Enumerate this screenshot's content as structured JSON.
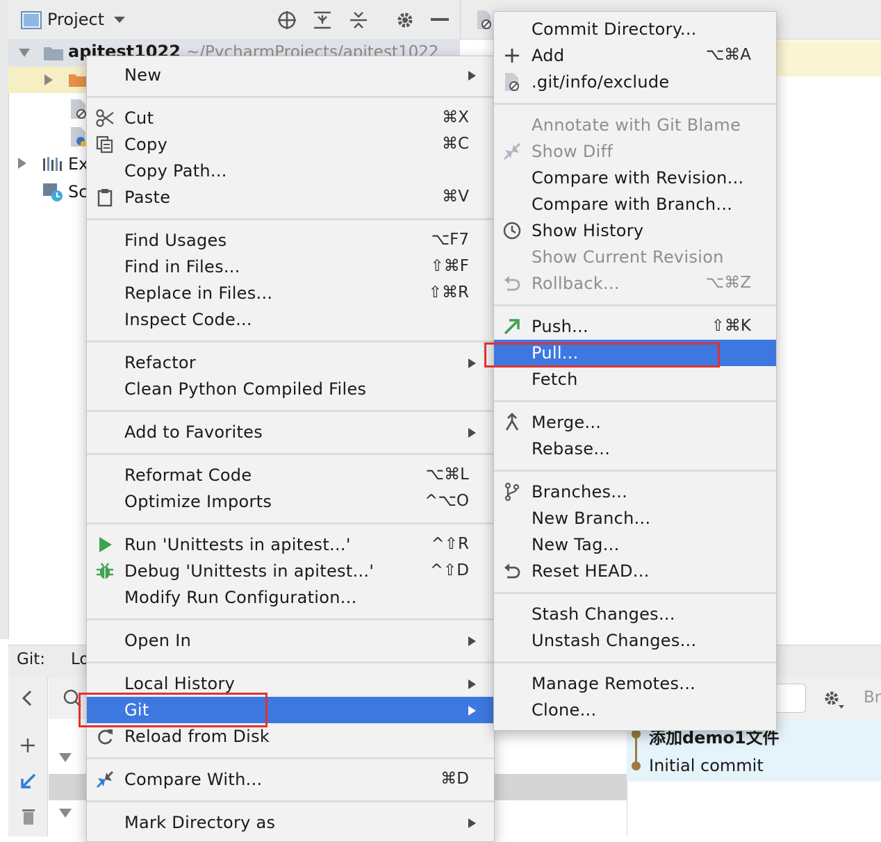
{
  "project_panel": {
    "title": "Project",
    "root_name": "apitest1022",
    "root_path": "~/PycharmProjects/apitest1022",
    "row_ex": "Ex",
    "row_sc": "Sc"
  },
  "git_panel": {
    "label": "Git:",
    "tab_partial": "Lo",
    "right_partial": "Br",
    "log": [
      "添加demo1文件",
      "Initial commit"
    ]
  },
  "context_menu": {
    "items": [
      {
        "label": "New",
        "arrow": true
      },
      {
        "label": "Cut",
        "shortcut": "⌘X",
        "icon": "scissors-icon"
      },
      {
        "label": "Copy",
        "shortcut": "⌘C",
        "icon": "copy-icon"
      },
      {
        "label": "Copy Path..."
      },
      {
        "label": "Paste",
        "shortcut": "⌘V",
        "icon": "clipboard-icon"
      },
      {
        "label": "Find Usages",
        "shortcut": "⌥F7"
      },
      {
        "label": "Find in Files...",
        "shortcut": "⇧⌘F"
      },
      {
        "label": "Replace in Files...",
        "shortcut": "⇧⌘R"
      },
      {
        "label": "Inspect Code..."
      },
      {
        "label": "Refactor",
        "arrow": true
      },
      {
        "label": "Clean Python Compiled Files"
      },
      {
        "label": "Add to Favorites",
        "arrow": true
      },
      {
        "label": "Reformat Code",
        "shortcut": "⌥⌘L"
      },
      {
        "label": "Optimize Imports",
        "shortcut": "^⌥O"
      },
      {
        "label": "Run 'Unittests in apitest...'",
        "shortcut": "^⇧R",
        "icon": "run-icon"
      },
      {
        "label": "Debug 'Unittests in apitest...'",
        "shortcut": "^⇧D",
        "icon": "debug-bug-icon"
      },
      {
        "label": "Modify Run Configuration..."
      },
      {
        "label": "Open In",
        "arrow": true
      },
      {
        "label": "Local History",
        "arrow": true
      },
      {
        "label": "Git",
        "arrow": true,
        "selected": true
      },
      {
        "label": "Reload from Disk",
        "icon": "reload-icon"
      },
      {
        "label": "Compare With...",
        "shortcut": "⌘D",
        "icon": "compare-icon"
      },
      {
        "label": "Mark Directory as",
        "arrow": true
      }
    ]
  },
  "git_submenu": {
    "items": [
      {
        "label": "Commit Directory..."
      },
      {
        "label": "Add",
        "shortcut": "⌥⌘A",
        "icon": "plus-icon"
      },
      {
        "label": ".git/info/exclude",
        "icon": "ignored-file-icon"
      },
      {
        "label": "Annotate with Git Blame",
        "disabled": true
      },
      {
        "label": "Show Diff",
        "disabled": true,
        "icon": "diff-arrows-icon"
      },
      {
        "label": "Compare with Revision..."
      },
      {
        "label": "Compare with Branch..."
      },
      {
        "label": "Show History",
        "icon": "clock-icon"
      },
      {
        "label": "Show Current Revision",
        "disabled": true
      },
      {
        "label": "Rollback...",
        "shortcut": "⌥⌘Z",
        "disabled": true,
        "icon": "rollback-icon"
      },
      {
        "label": "Push...",
        "shortcut": "⇧⌘K",
        "icon": "push-arrow-icon"
      },
      {
        "label": "Pull...",
        "selected": true
      },
      {
        "label": "Fetch"
      },
      {
        "label": "Merge...",
        "icon": "merge-icon"
      },
      {
        "label": "Rebase..."
      },
      {
        "label": "Branches...",
        "icon": "branch-icon"
      },
      {
        "label": "New Branch..."
      },
      {
        "label": "New Tag..."
      },
      {
        "label": "Reset HEAD...",
        "icon": "reset-icon"
      },
      {
        "label": "Stash Changes..."
      },
      {
        "label": "Unstash Changes..."
      },
      {
        "label": "Manage Remotes..."
      },
      {
        "label": "Clone..."
      }
    ]
  }
}
